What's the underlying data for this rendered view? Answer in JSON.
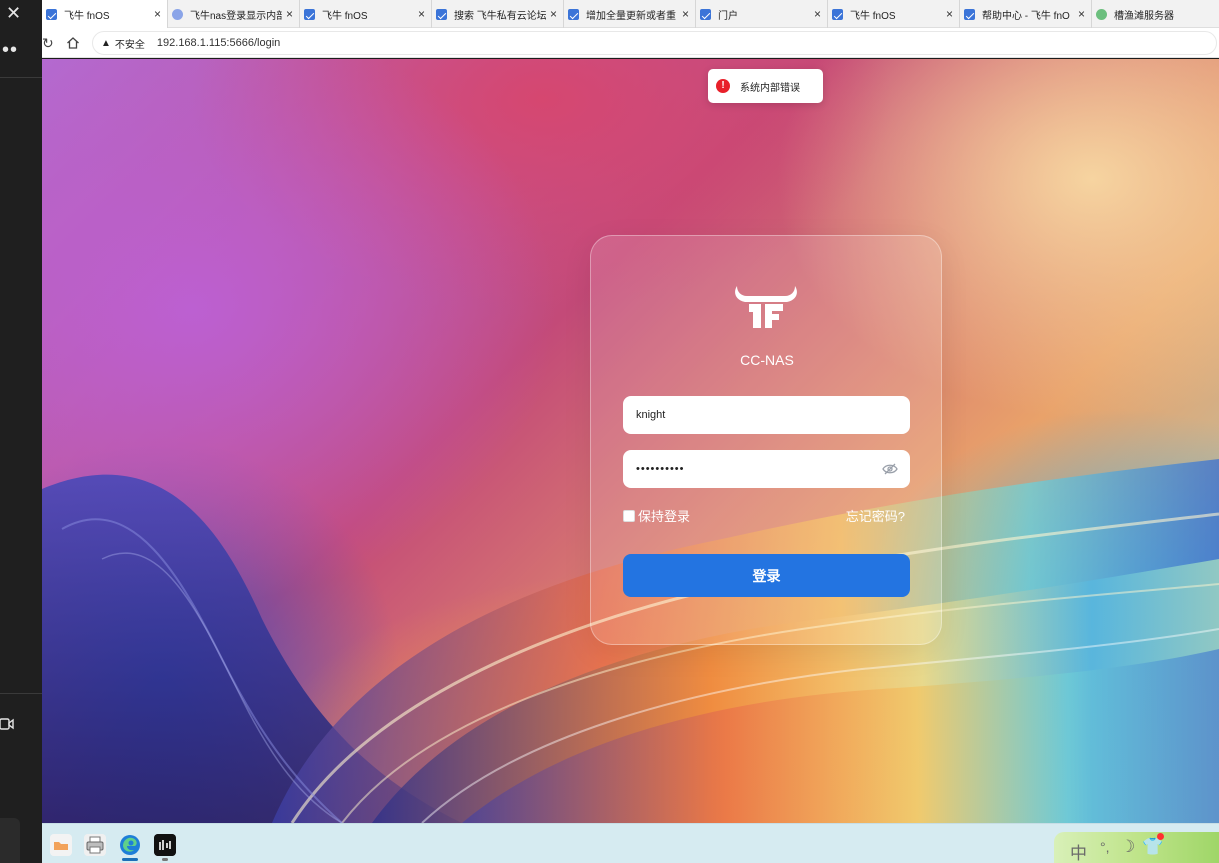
{
  "browser": {
    "tabs": [
      {
        "label": "飞牛 fnOS",
        "icon": "fnos-icon",
        "active": true
      },
      {
        "label": "飞牛nas登录显示内部",
        "icon": "baidu-paw-icon"
      },
      {
        "label": "飞牛 fnOS",
        "icon": "fnos-icon"
      },
      {
        "label": "搜索 飞牛私有云论坛",
        "icon": "fnos-icon"
      },
      {
        "label": "增加全量更新或者重",
        "icon": "fnos-icon"
      },
      {
        "label": "门户",
        "icon": "fnos-icon"
      },
      {
        "label": "飞牛 fnOS",
        "icon": "fnos-icon"
      },
      {
        "label": "帮助中心 - 飞牛 fnO",
        "icon": "fnos-icon"
      },
      {
        "label": "槽渔滩服务器",
        "icon": "server-icon"
      }
    ],
    "tab_close_glyph": "×",
    "security_label": "不安全",
    "url": "192.168.1.115:5666/login"
  },
  "toast": {
    "icon": "!",
    "message": "系统内部错误"
  },
  "login": {
    "device_name": "CC-NAS",
    "username_value": "knight",
    "password_mask": "••••••••••",
    "remember_label": "保持登录",
    "forgot_label": "忘记密码?",
    "submit_label": "登录"
  },
  "taskbar": {
    "apps": [
      "folder-icon",
      "printer-icon",
      "edge-icon",
      "capcut-icon"
    ]
  },
  "ime": {
    "language": "中",
    "punct": "°,",
    "mode_moon": "☽",
    "skin": "👕"
  },
  "colors": {
    "login_button": "#2374e1",
    "toast_error": "#e8202a",
    "taskbar": "#d6ebf1"
  }
}
